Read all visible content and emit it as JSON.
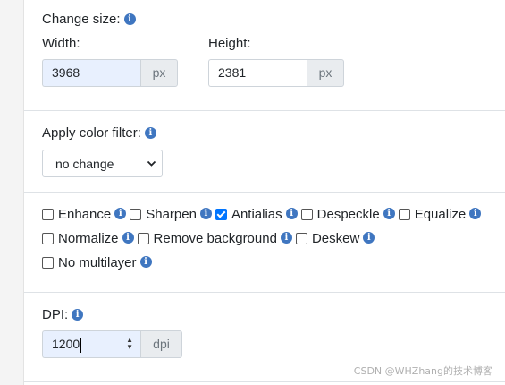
{
  "size": {
    "title": "Change size:",
    "width_label": "Width:",
    "height_label": "Height:",
    "width_value": "3968",
    "height_value": "2381",
    "unit": "px"
  },
  "filter": {
    "title": "Apply color filter:",
    "selected": "no change"
  },
  "options": {
    "row1": [
      {
        "label": "Enhance",
        "checked": false
      },
      {
        "label": "Sharpen",
        "checked": false
      },
      {
        "label": "Antialias",
        "checked": true
      },
      {
        "label": "Despeckle",
        "checked": false
      },
      {
        "label": "Equalize",
        "checked": false
      }
    ],
    "row2": [
      {
        "label": "Normalize",
        "checked": false
      },
      {
        "label": "Remove background",
        "checked": false
      },
      {
        "label": "Deskew",
        "checked": false
      }
    ],
    "row3": [
      {
        "label": "No multilayer",
        "checked": false
      }
    ]
  },
  "dpi": {
    "title": "DPI:",
    "value": "1200",
    "unit": "dpi"
  },
  "watermark": "CSDN @WHZhang的技术博客",
  "colors": {
    "info_icon": "#3f76c0",
    "checkbox_checked": "#0075ff",
    "active_input_bg": "#e8f0fe"
  }
}
